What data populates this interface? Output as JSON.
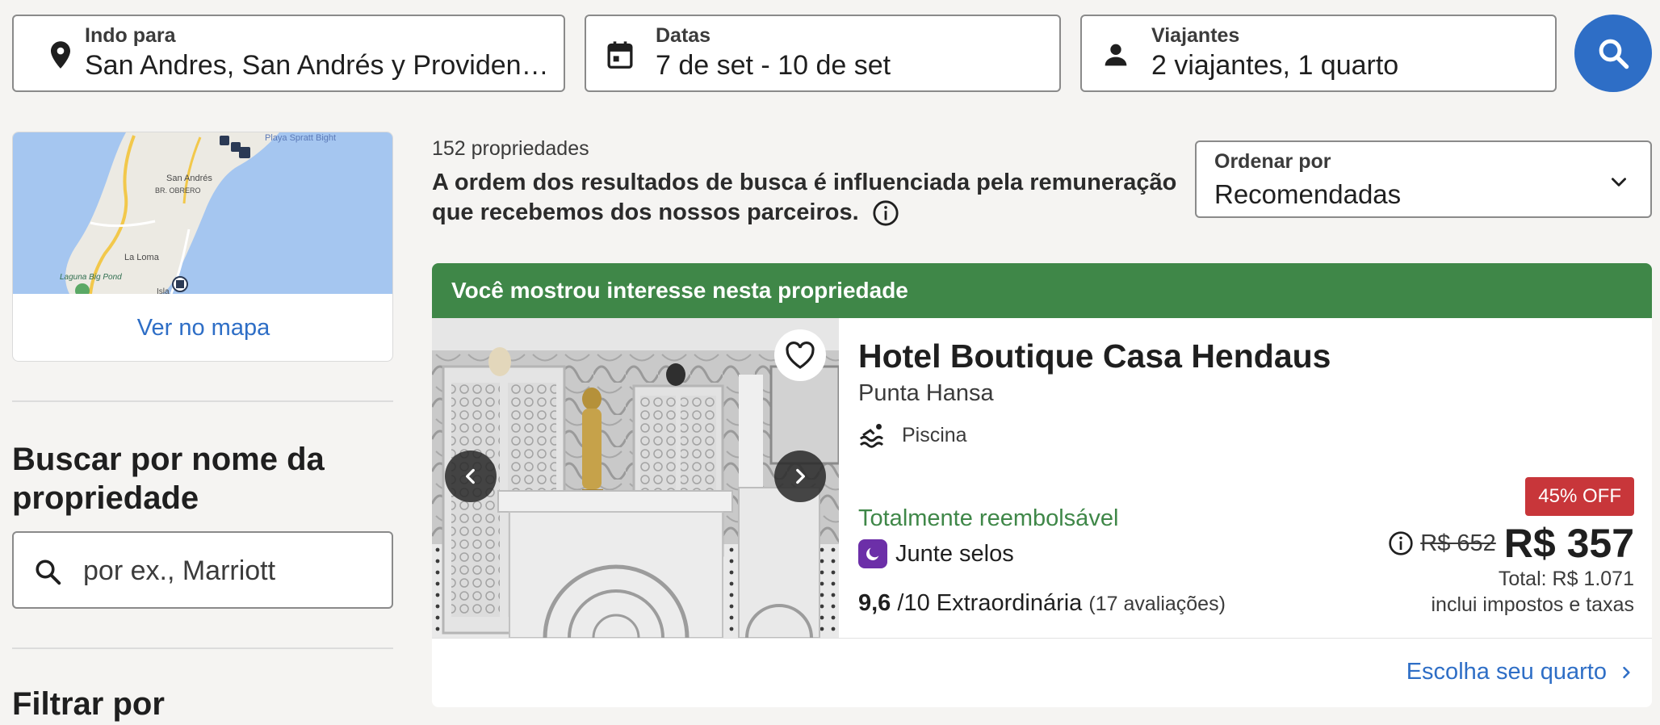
{
  "search": {
    "destination": {
      "label": "Indo para",
      "value": "San Andres, San Andrés y Providencia, Colômbia"
    },
    "dates": {
      "label": "Datas",
      "value": "7 de set - 10 de set"
    },
    "travelers": {
      "label": "Viajantes",
      "value": "2 viajantes, 1 quarto"
    },
    "search_icon": "search-icon"
  },
  "sidebar": {
    "map": {
      "labels": [
        "Playa Spratt Bight",
        "San Andrés",
        "BR. OBRERO",
        "La Loma",
        "Laguna Big Pond",
        "Isla"
      ],
      "link": "Ver no mapa"
    },
    "name_search": {
      "heading": "Buscar por nome da propriedade",
      "placeholder": "por ex., Marriott"
    },
    "filter_heading": "Filtrar por"
  },
  "results": {
    "count": "152 propriedades",
    "disclaimer": "A ordem dos resultados de busca é influenciada pela remuneração que recebemos dos nossos parceiros.",
    "sort": {
      "label": "Ordenar por",
      "value": "Recomendadas"
    }
  },
  "listing": {
    "banner": "Você mostrou interesse nesta propriedade",
    "name": "Hotel Boutique Casa Hendaus",
    "area": "Punta Hansa",
    "amenity": "Piscina",
    "refundable": "Totalmente reembolsável",
    "stamps": "Junte selos",
    "rating_score": "9,6",
    "rating_scale": "/10",
    "rating_label": "Extraordinária",
    "reviews": "(17 avaliações)",
    "discount": "45% OFF",
    "old_price": "R$ 652",
    "price": "R$ 357",
    "total": "Total: R$ 1.071",
    "taxes": "inclui impostos e taxas",
    "cta": "Escolha seu quarto"
  },
  "colors": {
    "accent": "#2e6ec6",
    "banner": "#3f8748",
    "discount": "#c8363a",
    "stamps": "#6c2fa8"
  }
}
